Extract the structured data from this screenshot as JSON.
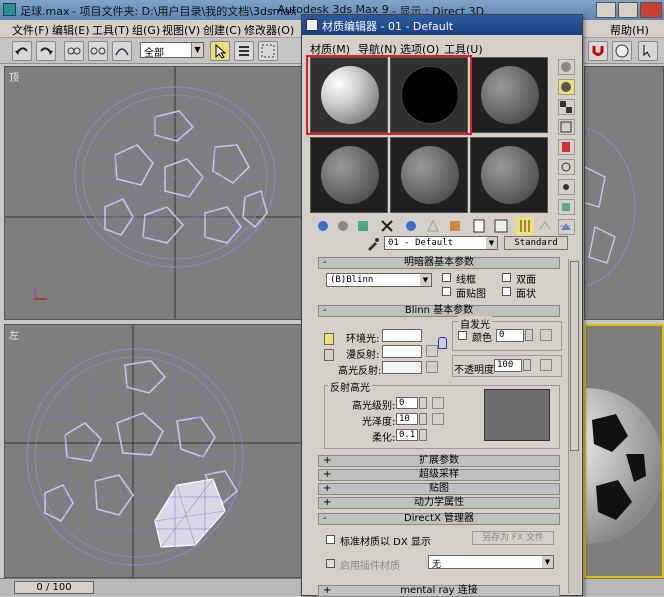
{
  "app": {
    "title_file": "足球.max",
    "title_project": "- 项目文件夹: D:\\用户目录\\我的文档\\3dsmax",
    "title_app": "- Autodesk 3ds Max 9",
    "title_display": "- 显示 : Direct 3D"
  },
  "menu": {
    "items": [
      "文件(F)",
      "编辑(E)",
      "工具(T)",
      "组(G)",
      "视图(V)",
      "创建(C)",
      "修改器(O)",
      "帮助(H)"
    ]
  },
  "toolbar": {
    "selection_filter": "全部"
  },
  "viewports": {
    "top_label": "顶",
    "left_label": "左"
  },
  "timeline": {
    "frame": "0 / 100"
  },
  "material_editor": {
    "title": "材质编辑器 - 01 - Default",
    "menu": [
      "材质(M)",
      "导航(N)",
      "选项(O)",
      "工具(U)"
    ],
    "material_name": "01 - Default",
    "material_type": "Standard",
    "shader_rollout": {
      "title": "明暗器基本参数",
      "shader": "(B)Blinn",
      "wire": "线框",
      "two_sided": "双面",
      "face_map": "面贴图",
      "faceted": "面状"
    },
    "blinn_rollout": {
      "title": "Blinn 基本参数",
      "ambient": "环境光:",
      "diffuse": "漫反射:",
      "specular": "高光反射:",
      "self_illum": "自发光",
      "color_label": "颜色",
      "color_value": "0",
      "opacity_label": "不透明度",
      "opacity_value": "100",
      "spec_highlights": "反射高光",
      "spec_level": "高光级别:",
      "spec_level_value": "0",
      "glossiness": "光泽度:",
      "glossiness_value": "10",
      "soften": "柔化:",
      "soften_value": "0.1"
    },
    "rollouts": [
      "扩展参数",
      "超级采样",
      "贴图",
      "动力学属性"
    ],
    "directx": {
      "title": "DirectX 管理器",
      "std_dx": "标准材质以 DX 显示",
      "save_as": "另存为  FX 文件",
      "enable_plugin": "启用插件材质",
      "plugin_value": "无"
    },
    "mental_ray": "mental ray 连接"
  },
  "colors": {
    "titlebar": "#6b93bd",
    "dialog_title": "#2856a0",
    "slot_highlight": "#e02020",
    "wire": "#8f86d8"
  }
}
